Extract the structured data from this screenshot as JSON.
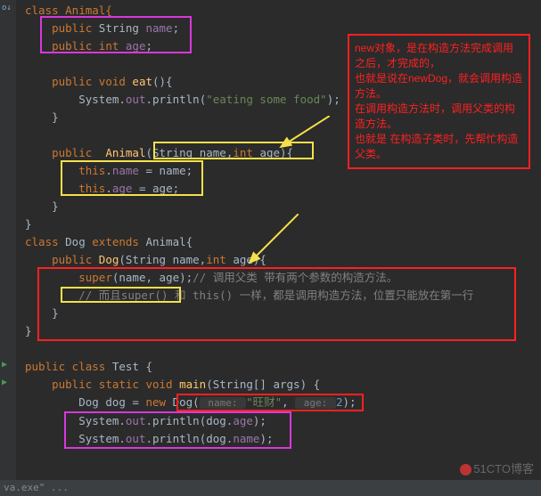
{
  "code": {
    "l1": "class Animal{",
    "l2_kw": "public",
    "l2_type": " String ",
    "l2_name": "name",
    "l2_end": ";",
    "l3_kw": "public int ",
    "l3_name": "age",
    "l3_end": ";",
    "l5_kw": "public void ",
    "l5_method": "eat",
    "l5_end": "(){",
    "l6a": "System.",
    "l6b": "out",
    "l6c": ".println(",
    "l6d": "\"eating some food\"",
    "l6e": ");",
    "l7": "}",
    "l9a": "public  ",
    "l9b": "Animal",
    "l9c": "(String ",
    "l9d": "name",
    "l9e": ",",
    "l9f": "int ",
    "l9g": "age",
    "l9h": "){",
    "l10a": "this",
    "l10b": ".",
    "l10c": "name",
    "l10d": " = name;",
    "l11a": "this",
    "l11b": ".",
    "l11c": "age",
    "l11d": " = age;",
    "l12": "    }",
    "l13": "}",
    "l14a": "class ",
    "l14b": "Dog ",
    "l14c": "extends ",
    "l14d": "Animal{",
    "l15a": "public ",
    "l15b": "Dog",
    "l15c": "(String name,",
    "l15d": "int ",
    "l15e": "age){",
    "l16a": "super",
    "l16b": "(name, age);",
    "l16c": "// 调用父类 带有两个参数的构造方法。",
    "l17": "// 而且super() 和 this() 一样，都是调用构造方法，位置只能放在第一行",
    "l18": "}",
    "l19": "}",
    "l21a": "public class ",
    "l21b": "Test ",
    "l21c": "{",
    "l22a": "public static void ",
    "l22b": "main",
    "l22c": "(String[] args) {",
    "l23a": "Dog dog = ",
    "l23b": "new ",
    "l23c": "Dog(",
    "l23h1": " name: ",
    "l23d": "\"旺财\"",
    "l23e": ", ",
    "l23h2": " age: ",
    "l23f": "2",
    "l23g": ");",
    "l24a": "System.",
    "l24b": "out",
    "l24c": ".println(dog.",
    "l24d": "age",
    "l24e": ");",
    "l25a": "System.",
    "l25b": "out",
    "l25c": ".println(dog.",
    "l25d": "name",
    "l25e": ");"
  },
  "annotation": {
    "t1": "new对象，是在构造方法完成调用之后，才完成的，",
    "t2": "也就是说在newDog，就会调用构造方法。",
    "t3": "在调用构造方法时，调用父类的构造方法。",
    "t4": "也就是 在构造子类时，先帮忙构造父类。"
  },
  "watermark": "51CTO博客",
  "bottombar": "va.exe\" ..."
}
